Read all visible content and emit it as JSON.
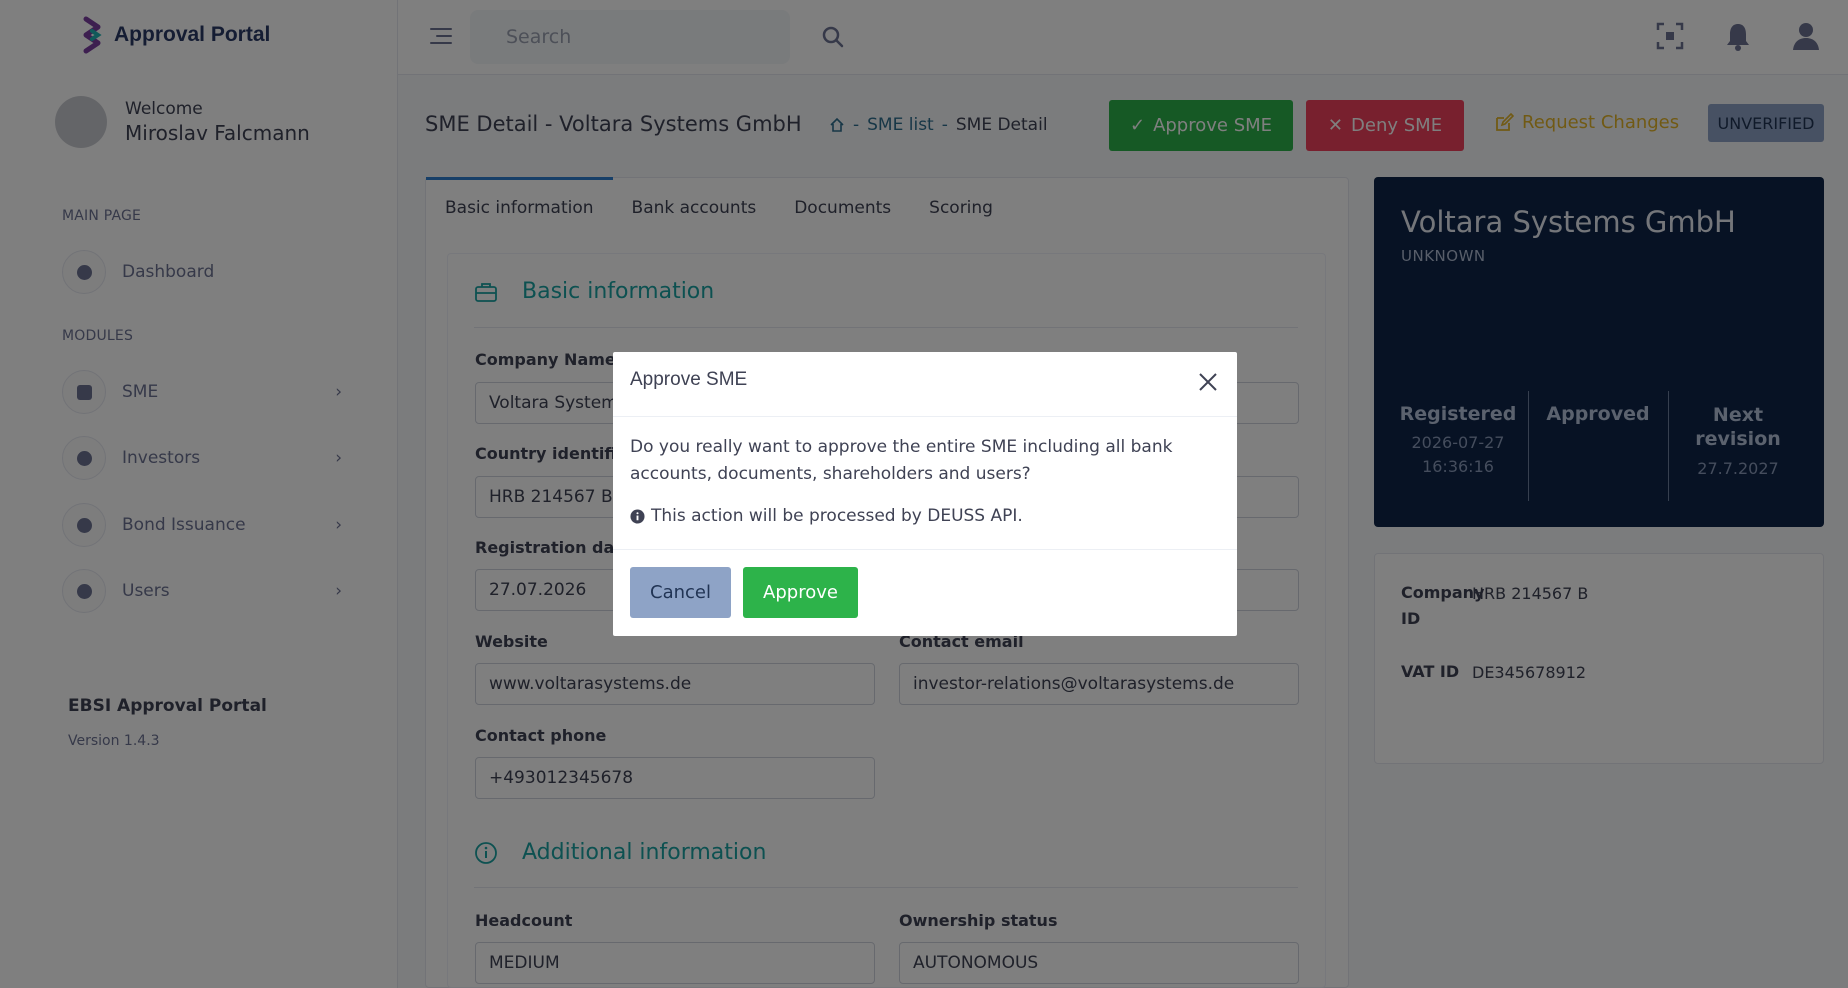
{
  "app": {
    "title": "Approval Portal"
  },
  "user": {
    "welcome": "Welcome",
    "name": "Miroslav Falcmann"
  },
  "sidebar": {
    "section_main": "MAIN PAGE",
    "section_modules": "MODULES",
    "items": [
      {
        "label": "Dashboard",
        "icon": "pie-chart-icon"
      },
      {
        "label": "SME",
        "icon": "dice-icon"
      },
      {
        "label": "Investors",
        "icon": "person-icon"
      },
      {
        "label": "Bond Issuance",
        "icon": "pie-chart-icon"
      },
      {
        "label": "Users",
        "icon": "person-icon"
      }
    ],
    "footer_title": "EBSI Approval Portal",
    "footer_version": "Version 1.4.3"
  },
  "topbar": {
    "search_placeholder": "Search"
  },
  "page": {
    "title": "SME Detail - Voltara Systems GmbH",
    "breadcrumb": [
      "SME list",
      "SME Detail"
    ],
    "breadcrumb_sep": "-",
    "approve_label": "Approve SME",
    "deny_label": "Deny SME",
    "request_label": "Request Changes",
    "status_badge": "UNVERIFIED"
  },
  "tabs": [
    "Basic information",
    "Bank accounts",
    "Documents",
    "Scoring"
  ],
  "basic": {
    "heading": "Basic information",
    "company_name_label": "Company Name",
    "company_name_value": "Voltara Systems",
    "country_id_label": "Country identifica",
    "country_id_value": "HRB 214567 B",
    "reg_date_label": "Registration date",
    "reg_date_value": "27.07.2026",
    "website_label": "Website",
    "website_value": "www.voltarasystems.de",
    "contact_email_label": "Contact email",
    "contact_email_value": "investor-relations@voltarasystems.de",
    "contact_phone_label": "Contact phone",
    "contact_phone_value": "+493012345678"
  },
  "additional": {
    "heading": "Additional information",
    "headcount_label": "Headcount",
    "headcount_value": "MEDIUM",
    "ownership_label": "Ownership status",
    "ownership_value": "AUTONOMOUS"
  },
  "summary": {
    "name": "Voltara Systems GmbH",
    "status": "UNKNOWN",
    "registered_label": "Registered",
    "registered_value": "2026-07-27 16:36:16",
    "approved_label": "Approved",
    "next_revision_label": "Next revision",
    "next_revision_value": "27.7.2027"
  },
  "ids": {
    "company_id_label": "Company ID",
    "company_id_value": "HRB 214567 B",
    "vat_id_label": "VAT ID",
    "vat_id_value": "DE345678912"
  },
  "modal": {
    "title": "Approve SME",
    "body": "Do you really want to approve the entire SME including all bank accounts, documents, shareholders and users?",
    "note": "This action will be processed by DEUSS API.",
    "cancel_label": "Cancel",
    "approve_label": "Approve"
  },
  "colors": {
    "accent_green": "#2db34a",
    "deny_red": "#f1405c",
    "warning_yellow": "#e3b429",
    "teal": "#1aa3a3",
    "navy": "#0f2548"
  }
}
